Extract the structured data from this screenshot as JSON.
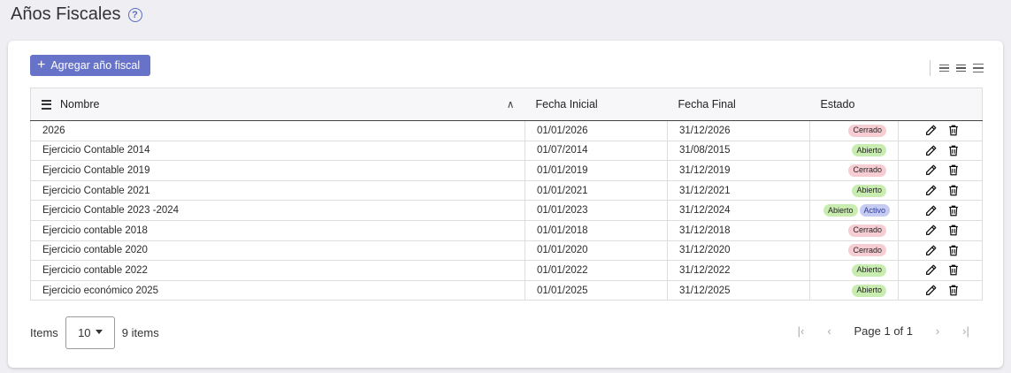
{
  "header": {
    "title": "Años Fiscales",
    "help_icon": "question-circle-icon"
  },
  "toolbar": {
    "add_label": "Agregar año fiscal",
    "add_icon": "plus-icon"
  },
  "table": {
    "columns": {
      "name": "Nombre",
      "start": "Fecha Inicial",
      "end": "Fecha Final",
      "status": "Estado"
    },
    "rows": [
      {
        "name": "2026",
        "start": "01/01/2026",
        "end": "31/12/2026",
        "badges": [
          {
            "label": "Cerrado",
            "kind": "cerrado"
          }
        ]
      },
      {
        "name": "Ejercicio Contable 2014",
        "start": "01/07/2014",
        "end": "31/08/2015",
        "badges": [
          {
            "label": "Abierto",
            "kind": "abierto"
          }
        ]
      },
      {
        "name": "Ejercicio Contable 2019",
        "start": "01/01/2019",
        "end": "31/12/2019",
        "badges": [
          {
            "label": "Cerrado",
            "kind": "cerrado"
          }
        ]
      },
      {
        "name": "Ejercicio Contable 2021",
        "start": "01/01/2021",
        "end": "31/12/2021",
        "badges": [
          {
            "label": "Abierto",
            "kind": "abierto"
          }
        ]
      },
      {
        "name": "Ejercicio Contable 2023 -2024",
        "start": "01/01/2023",
        "end": "31/12/2024",
        "badges": [
          {
            "label": "Abierto",
            "kind": "abierto"
          },
          {
            "label": "Activo",
            "kind": "activo"
          }
        ]
      },
      {
        "name": "Ejercicio contable 2018",
        "start": "01/01/2018",
        "end": "31/12/2018",
        "badges": [
          {
            "label": "Cerrado",
            "kind": "cerrado"
          }
        ]
      },
      {
        "name": "Ejercicio contable 2020",
        "start": "01/01/2020",
        "end": "31/12/2020",
        "badges": [
          {
            "label": "Cerrado",
            "kind": "cerrado"
          }
        ]
      },
      {
        "name": "Ejercicio contable 2022",
        "start": "01/01/2022",
        "end": "31/12/2022",
        "badges": [
          {
            "label": "Abierto",
            "kind": "abierto"
          }
        ]
      },
      {
        "name": "Ejercicio económico 2025",
        "start": "01/01/2025",
        "end": "31/12/2025",
        "badges": [
          {
            "label": "Abierto",
            "kind": "abierto"
          }
        ]
      }
    ]
  },
  "footer": {
    "items_label": "Items",
    "page_size": "10",
    "count_text": "9 items",
    "page_text": "Page 1 of 1"
  },
  "colors": {
    "accent": "#6673c8",
    "cerrado": "#f6cdd3",
    "abierto": "#c9ecb0",
    "activo": "#c6cbf2"
  }
}
